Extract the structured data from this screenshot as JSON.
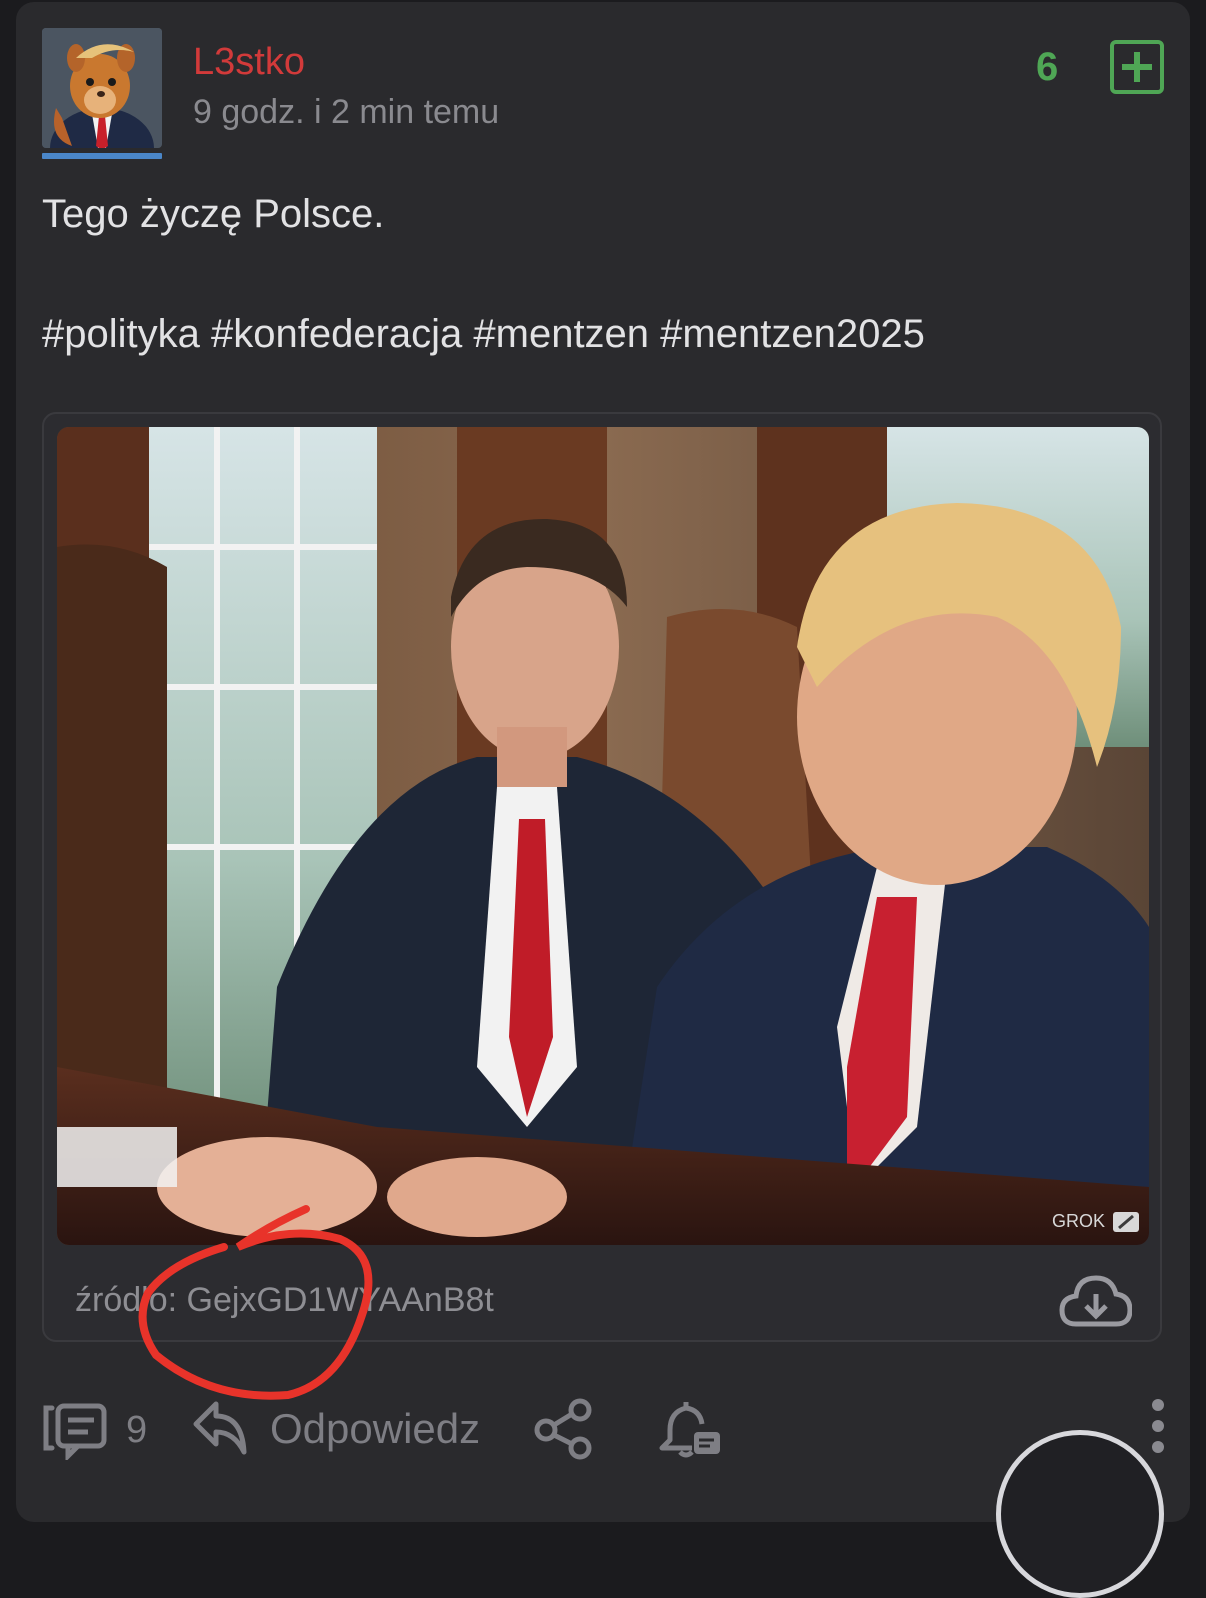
{
  "post": {
    "author": "L3stko",
    "time": "9 godz. i 2 min temu",
    "votes": "6",
    "body": "Tego życzę Polsce.",
    "tags": "#polityka #konfederacja #mentzen #mentzen2025",
    "image_watermark": "GROK",
    "source": "źródło: GejxGD1WYAAnB8t"
  },
  "actions": {
    "comments_count": "9",
    "reply_label": "Odpowiedz"
  },
  "colors": {
    "author": "#d23a3a",
    "vote": "#4fa655",
    "annotation": "#e8332a",
    "avatar_underline": "#4a86c8"
  },
  "icons": [
    "plus-square-icon",
    "cloud-download-icon",
    "comments-icon",
    "reply-icon",
    "share-icon",
    "bell-icon",
    "more-vertical-icon"
  ]
}
